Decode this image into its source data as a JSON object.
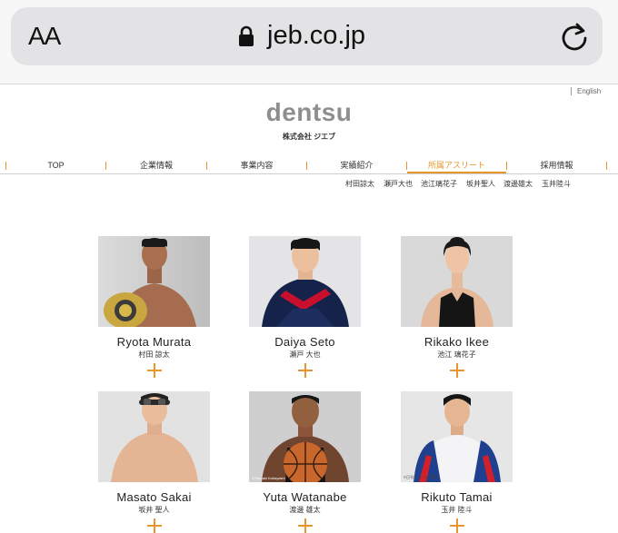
{
  "browser": {
    "text_size_label": "AA",
    "domain": "jeb.co.jp"
  },
  "header": {
    "language_link": "English",
    "logo": "dentsu",
    "company_name": "株式会社 ジエブ"
  },
  "nav": {
    "items": [
      "TOP",
      "企業情報",
      "事業内容",
      "実績紹介",
      "所属アスリート",
      "採用情報"
    ],
    "active_index": 4
  },
  "subnav": {
    "items": [
      "村田諒太",
      "瀬戸大也",
      "池江璃花子",
      "坂井聖人",
      "渡邊雄太",
      "玉井陸斗"
    ]
  },
  "athletes": [
    {
      "name": "Ryota Murata",
      "jname": "村田 諒太",
      "photo_credit": ""
    },
    {
      "name": "Daiya Seto",
      "jname": "瀬戸 大也",
      "photo_credit": ""
    },
    {
      "name": "Rikako Ikee",
      "jname": "池江 璃花子",
      "photo_credit": ""
    },
    {
      "name": "Masato Sakai",
      "jname": "坂井 聖人",
      "photo_credit": ""
    },
    {
      "name": "Yuta Watanabe",
      "jname": "渡邊 雄太",
      "photo_credit": "©Yasuaki Kobayashi"
    },
    {
      "name": "Rikuto Tamai",
      "jname": "玉井 陸斗",
      "photo_credit": "©日刊スポーツ新聞社"
    }
  ],
  "colors": {
    "accent": "#e8962c",
    "logo": "#8e8e8e"
  }
}
